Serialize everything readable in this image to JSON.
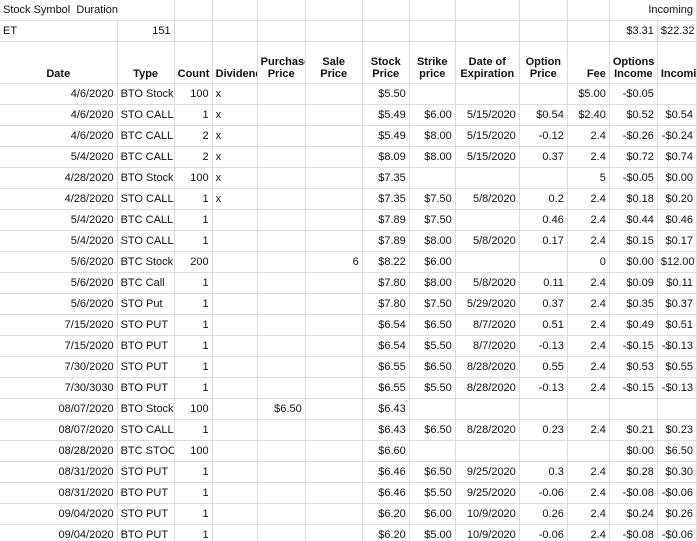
{
  "top": {
    "r1": {
      "label_symbol": "Stock Symbol",
      "label_duration": "Duration",
      "label_incoming": "Incoming"
    },
    "r2": {
      "symbol": "ET",
      "duration": "151",
      "options_income_total": "$3.31",
      "incoming_total": "$22.32"
    }
  },
  "headers": [
    "Date",
    "Type",
    "Count",
    "Dividend",
    "Purchase Price",
    "Sale Price",
    "Stock Price",
    "Strike price",
    "Date of Expiration",
    "Option Price",
    "Fee",
    "Options Income",
    "Incoming"
  ],
  "rows": [
    [
      "4/6/2020",
      "BTO Stock",
      "100",
      "x",
      "",
      "",
      "$5.50",
      "",
      "",
      "",
      "$5.00",
      "-$0.05",
      ""
    ],
    [
      "4/6/2020",
      "STO CALL",
      "1",
      "x",
      "",
      "",
      "$5.49",
      "$6.00",
      "5/15/2020",
      "$0.54",
      "$2.40",
      "$0.52",
      "$0.54"
    ],
    [
      "4/6/2020",
      "BTC CALL",
      "2",
      "x",
      "",
      "",
      "$5.49",
      "$8.00",
      "5/15/2020",
      "-0.12",
      "2.4",
      "-$0.26",
      "-$0.24"
    ],
    [
      "5/4/2020",
      "BTC CALL",
      "2",
      "x",
      "",
      "",
      "$8.09",
      "$8.00",
      "5/15/2020",
      "0.37",
      "2.4",
      "$0.72",
      "$0.74"
    ],
    [
      "4/28/2020",
      "BTO Stock",
      "100",
      "x",
      "",
      "",
      "$7.35",
      "",
      "",
      "",
      "5",
      "-$0.05",
      "$0.00"
    ],
    [
      "4/28/2020",
      "STO CALL",
      "1",
      "x",
      "",
      "",
      "$7.35",
      "$7.50",
      "5/8/2020",
      "0.2",
      "2.4",
      "$0.18",
      "$0.20"
    ],
    [
      "5/4/2020",
      "BTC CALL",
      "1",
      "",
      "",
      "",
      "$7.89",
      "$7.50",
      "",
      "0.46",
      "2.4",
      "$0.44",
      "$0.46"
    ],
    [
      "5/4/2020",
      "STO CALL",
      "1",
      "",
      "",
      "",
      "$7.89",
      "$8.00",
      "5/8/2020",
      "0.17",
      "2.4",
      "$0.15",
      "$0.17"
    ],
    [
      "5/6/2020",
      "BTC Stock",
      "200",
      "",
      "",
      "6",
      "$8.22",
      "$6.00",
      "",
      "",
      "0",
      "$0.00",
      "$12.00"
    ],
    [
      "5/6/2020",
      "BTC Call",
      "1",
      "",
      "",
      "",
      "$7.80",
      "$8.00",
      "5/8/2020",
      "0.11",
      "2.4",
      "$0.09",
      "$0.11"
    ],
    [
      "5/6/2020",
      "STO Put",
      "1",
      "",
      "",
      "",
      "$7.80",
      "$7.50",
      "5/29/2020",
      "0.37",
      "2.4",
      "$0.35",
      "$0.37"
    ],
    [
      "7/15/2020",
      "STO PUT",
      "1",
      "",
      "",
      "",
      "$6.54",
      "$6.50",
      "8/7/2020",
      "0.51",
      "2.4",
      "$0.49",
      "$0.51"
    ],
    [
      "7/15/2020",
      "BTO PUT",
      "1",
      "",
      "",
      "",
      "$6.54",
      "$5.50",
      "8/7/2020",
      "-0.13",
      "2.4",
      "-$0.15",
      "-$0.13"
    ],
    [
      "7/30/2020",
      "STO PUT",
      "1",
      "",
      "",
      "",
      "$6.55",
      "$6.50",
      "8/28/2020",
      "0.55",
      "2.4",
      "$0.53",
      "$0.55"
    ],
    [
      "7/30/3030",
      "BTO PUT",
      "1",
      "",
      "",
      "",
      "$6.55",
      "$5.50",
      "8/28/2020",
      "-0.13",
      "2.4",
      "-$0.15",
      "-$0.13"
    ],
    [
      "08/07/2020",
      "BTO Stock",
      "100",
      "",
      "$6.50",
      "",
      "$6.43",
      "",
      "",
      "",
      "",
      "",
      ""
    ],
    [
      "08/07/2020",
      "STO CALL",
      "1",
      "",
      "",
      "",
      "$6.43",
      "$6.50",
      "8/28/2020",
      "0.23",
      "2.4",
      "$0.21",
      "$0.23"
    ],
    [
      "08/28/2020",
      "BTC STOCK",
      "100",
      "",
      "",
      "",
      "$6.60",
      "",
      "",
      "",
      "",
      "$0.00",
      "$6.50"
    ],
    [
      "08/31/2020",
      "STO PUT",
      "1",
      "",
      "",
      "",
      "$6.46",
      "$6.50",
      "9/25/2020",
      "0.3",
      "2.4",
      "$0.28",
      "$0.30"
    ],
    [
      "08/31/2020",
      "BTO PUT",
      "1",
      "",
      "",
      "",
      "$6.46",
      "$5.50",
      "9/25/2020",
      "-0.06",
      "2.4",
      "-$0.08",
      "-$0.06"
    ],
    [
      "09/04/2020",
      "STO PUT",
      "1",
      "",
      "",
      "",
      "$6.20",
      "$6.00",
      "10/9/2020",
      "0.26",
      "2.4",
      "$0.24",
      "$0.26"
    ],
    [
      "09/04/2020",
      "BTO PUT",
      "1",
      "",
      "",
      "",
      "$6.20",
      "$5.00",
      "10/9/2020",
      "-0.06",
      "2.4",
      "-$0.08",
      "-$0.06"
    ]
  ]
}
